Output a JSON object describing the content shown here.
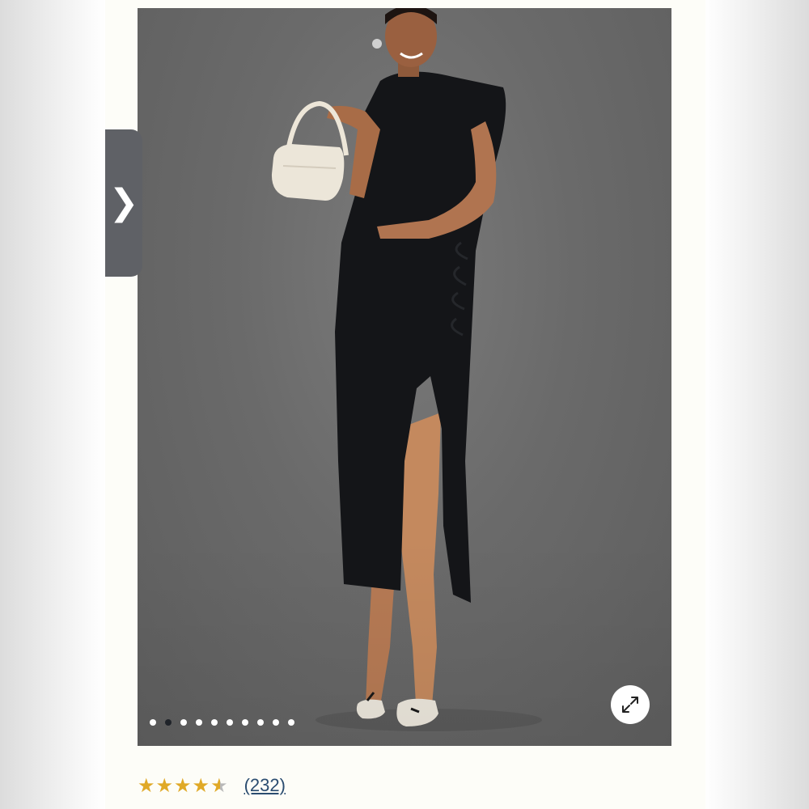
{
  "gallery": {
    "image_alt": "Model wearing black ruched midi dress with side slit, holding white handbag",
    "slide_count": 10,
    "active_slide": 2,
    "prev_glyph": "❯",
    "expand_icon": "expand-arrows-icon"
  },
  "rating": {
    "value": 4.5,
    "max": 5,
    "star_glyph": "★",
    "review_count": "(232)"
  },
  "colors": {
    "star": "#e0a927",
    "link": "#2a4c70",
    "active_dot": "#1f2329"
  }
}
